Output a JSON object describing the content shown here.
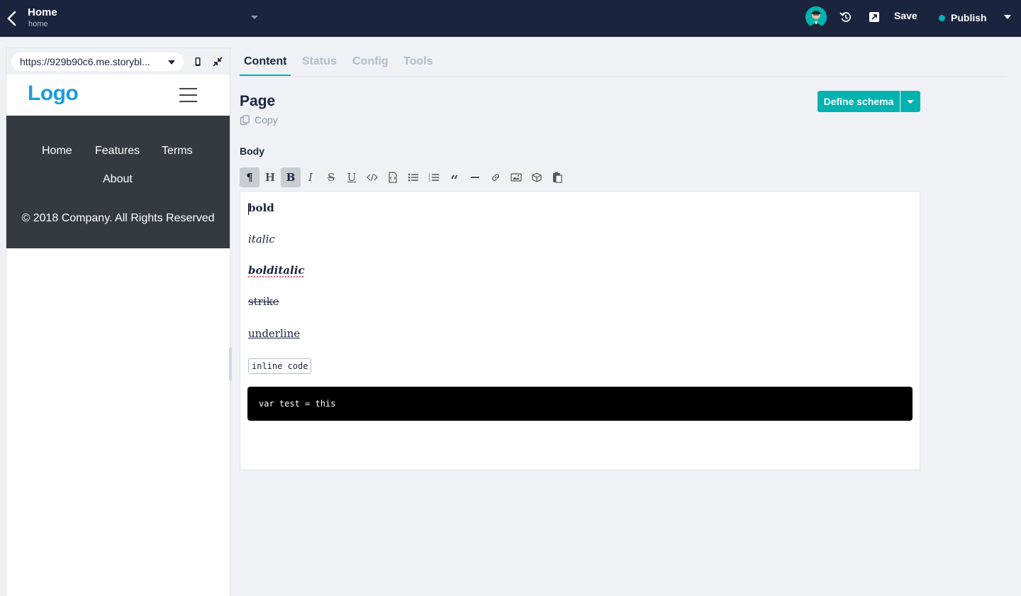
{
  "topbar": {
    "title": "Home",
    "slug": "home",
    "save_label": "Save",
    "publish_label": "Publish",
    "status_color": "#00b3b0",
    "bg_color": "#1b243f"
  },
  "preview": {
    "url": "https://929b90c6.me.storybl...",
    "site": {
      "logo": "Logo",
      "nav": [
        "Home",
        "Features",
        "Terms",
        "About"
      ],
      "footer": "© 2018 Company. All Rights Reserved"
    }
  },
  "tabs": [
    {
      "label": "Content",
      "active": true
    },
    {
      "label": "Status",
      "active": false
    },
    {
      "label": "Config",
      "active": false
    },
    {
      "label": "Tools",
      "active": false
    }
  ],
  "block": {
    "title": "Page",
    "copy_label": "Copy",
    "define_schema_label": "Define schema"
  },
  "field": {
    "label": "Body",
    "toolbar_icons": [
      "paragraph-icon",
      "heading-icon",
      "bold-icon",
      "italic-icon",
      "strike-icon",
      "underline-icon",
      "code-icon",
      "code-block-icon",
      "bullet-list-icon",
      "ordered-list-icon",
      "quote-icon",
      "horizontal-rule-icon",
      "link-icon",
      "image-icon",
      "blok-icon",
      "paste-icon"
    ],
    "content": {
      "bold": "bold",
      "italic": "italic",
      "bolditalic": "bolditalic",
      "strike": "strike",
      "underline": "underline",
      "inline_code": "inline code",
      "code_block": "var test = this"
    }
  },
  "colors": {
    "accent": "#00b3b0",
    "logo": "#1a9be0",
    "site_nav_bg": "#343a40"
  }
}
